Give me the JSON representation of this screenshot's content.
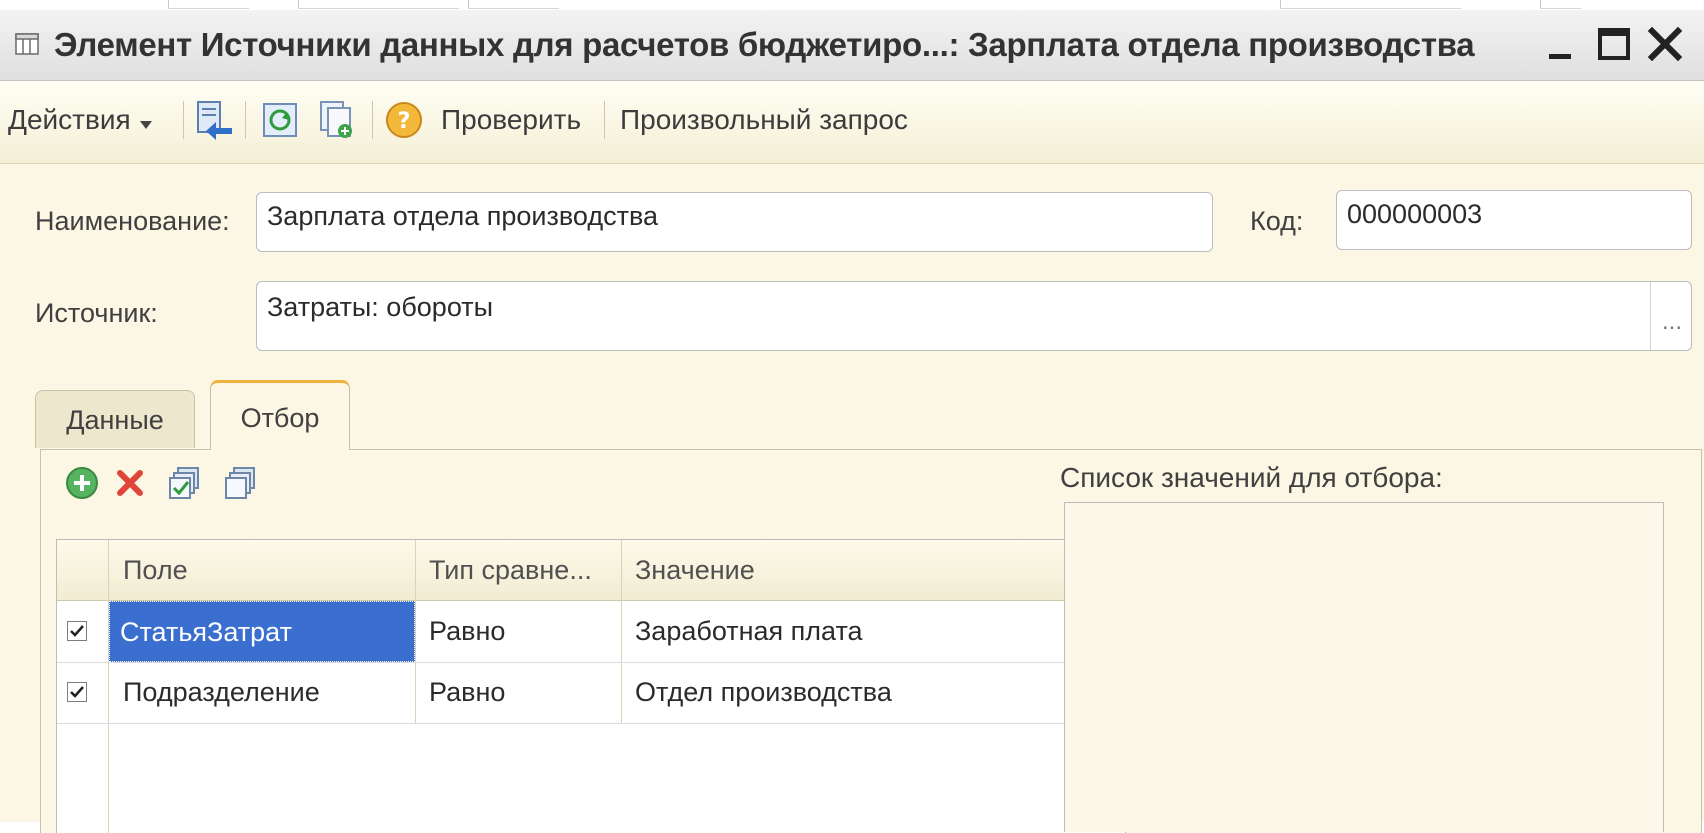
{
  "window": {
    "title": "Элемент Источники данных для расчетов бюджетиро...: Зарплата отдела производства"
  },
  "toolbar": {
    "actions_label": "Действия",
    "check_label": "Проверить",
    "query_label": "Произвольный запрос",
    "icons": [
      "import-icon",
      "refresh-icon",
      "copy-icon",
      "help-icon"
    ]
  },
  "form": {
    "name_label": "Наименование:",
    "name_value": "Зарплата отдела производства",
    "code_label": "Код:",
    "code_value": "000000003",
    "source_label": "Источник:",
    "source_value": "Затраты: обороты",
    "select_button": "..."
  },
  "tabs": [
    {
      "label": "Данные",
      "active": false
    },
    {
      "label": "Отбор",
      "active": true
    }
  ],
  "filter": {
    "toolbar_icons": [
      "add-icon",
      "delete-icon",
      "check-all-icon",
      "uncheck-all-icon"
    ],
    "columns": [
      "Поле",
      "Тип сравне...",
      "Значение"
    ],
    "rows": [
      {
        "checked": true,
        "field": "СтатьяЗатрат",
        "comparison": "Равно",
        "value": "Заработная плата"
      },
      {
        "checked": true,
        "field": "Подразделение",
        "comparison": "Равно",
        "value": "Отдел производства"
      }
    ],
    "values_list_label": "Список значений для отбора:"
  },
  "colors": {
    "form_background": "#fbf7e4",
    "selection": "#3b6fcf",
    "tab_accent": "#f0b23c"
  }
}
